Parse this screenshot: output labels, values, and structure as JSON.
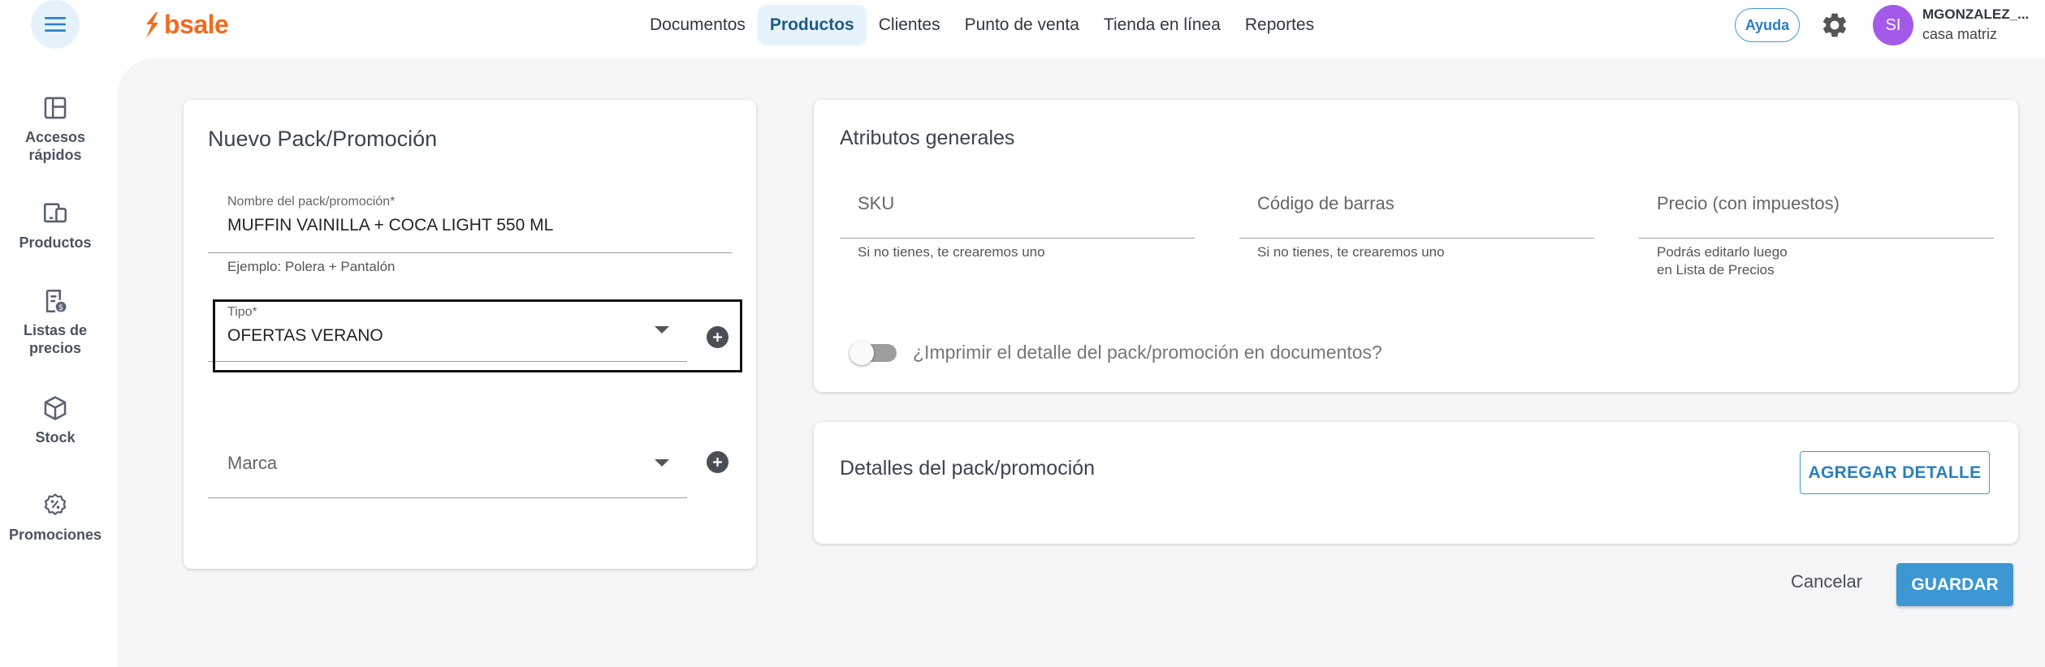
{
  "app": {
    "logo_text": "bsale",
    "brand_color": "#f36a1d",
    "accent_color": "#3c97d3"
  },
  "header": {
    "menu_icon": "hamburger-icon",
    "nav": [
      {
        "label": "Documentos",
        "active": false
      },
      {
        "label": "Productos",
        "active": true
      },
      {
        "label": "Clientes",
        "active": false
      },
      {
        "label": "Punto de venta",
        "active": false
      },
      {
        "label": "Tienda en línea",
        "active": false
      },
      {
        "label": "Reportes",
        "active": false
      }
    ],
    "help_label": "Ayuda",
    "settings_icon": "gear-icon",
    "user": {
      "initials": "SI",
      "name": "MGONZALEZ_...",
      "branch": "casa matriz"
    }
  },
  "sidebar": {
    "items": [
      {
        "label": "Accesos rápidos",
        "icon": "dashboard-icon"
      },
      {
        "label": "Productos",
        "icon": "devices-icon"
      },
      {
        "label": "Listas de precios",
        "icon": "price-list-icon"
      },
      {
        "label": "Stock",
        "icon": "box-icon"
      },
      {
        "label": "Promociones",
        "icon": "discount-icon"
      }
    ]
  },
  "form": {
    "title": "Nuevo Pack/Promoción",
    "name_label": "Nombre del pack/promoción*",
    "name_value": "MUFFIN VAINILLA + COCA LIGHT 550 ML",
    "name_helper": "Ejemplo: Polera + Pantalón",
    "type_label": "Tipo*",
    "type_value": "OFERTAS VERANO",
    "brand_placeholder": "Marca"
  },
  "attributes": {
    "title": "Atributos generales",
    "sku_placeholder": "SKU",
    "sku_helper": "Si no tienes, te crearemos uno",
    "barcode_placeholder": "Código de barras",
    "barcode_helper": "Si no tienes, te crearemos uno",
    "price_placeholder": "Precio (con impuestos)",
    "price_helper_1": "Podrás editarlo luego",
    "price_helper_2": "en Lista de Precios",
    "print_toggle_label": "¿Imprimir el detalle del pack/promoción en documentos?",
    "print_toggle_on": false
  },
  "details": {
    "title": "Detalles del pack/promoción",
    "add_detail_label": "AGREGAR DETALLE"
  },
  "actions": {
    "cancel_label": "Cancelar",
    "save_label": "GUARDAR"
  }
}
